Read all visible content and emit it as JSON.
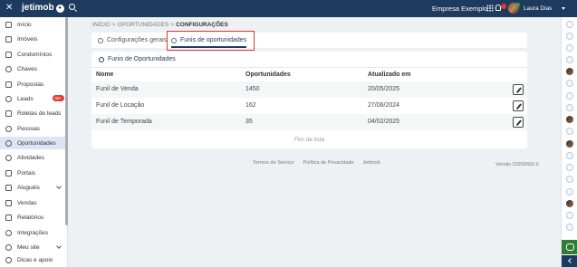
{
  "app": {
    "logo_text": "jetimob",
    "company": "Empresa Exemplo",
    "user_name": "Laura Dias"
  },
  "sidebar": {
    "items": [
      {
        "label": "Início",
        "icon": "home-icon"
      },
      {
        "label": "Imóveis",
        "icon": "building-icon"
      },
      {
        "label": "Condomínios",
        "icon": "condo-icon"
      },
      {
        "label": "Chaves",
        "icon": "key-icon"
      },
      {
        "label": "Propostas",
        "icon": "proposal-icon"
      },
      {
        "label": "Leads",
        "icon": "leads-icon",
        "badge": "99+"
      },
      {
        "label": "Roletas de leads",
        "icon": "roulette-icon"
      },
      {
        "label": "Pessoas",
        "icon": "people-icon"
      },
      {
        "label": "Oportunidades",
        "icon": "opportunity-icon",
        "active": true
      },
      {
        "label": "Atividades",
        "icon": "check-icon"
      },
      {
        "label": "Portais",
        "icon": "megaphone-icon"
      },
      {
        "label": "Aluguéis",
        "icon": "rent-icon",
        "expandable": true
      },
      {
        "label": "Vendas",
        "icon": "sales-icon"
      },
      {
        "label": "Relatórios",
        "icon": "report-icon"
      },
      {
        "label": "Integrações",
        "icon": "integration-icon"
      },
      {
        "label": "Meu site",
        "icon": "globe-icon",
        "expandable": true
      },
      {
        "label": "Dicas e apoio",
        "icon": "help-icon"
      }
    ]
  },
  "breadcrumb": {
    "items": [
      "INÍCIO",
      "OPORTUNIDADES",
      "CONFIGURAÇÕES"
    ],
    "separator": ">"
  },
  "tabs": [
    {
      "label": "Configurações gerais",
      "active": false
    },
    {
      "label": "Funis de oportunidades",
      "active": true
    }
  ],
  "funnels": {
    "title": "Funis de Oportunidades",
    "columns": [
      "Nome",
      "Oportunidades",
      "Atualizado em"
    ],
    "rows": [
      {
        "name": "Funil de Venda",
        "count": "1450",
        "updated": "20/05/2025"
      },
      {
        "name": "Funil de Locação",
        "count": "162",
        "updated": "27/06/2024"
      },
      {
        "name": "Funil de Temporada",
        "count": "35",
        "updated": "04/02/2025"
      }
    ],
    "end_text": "Fim da lista"
  },
  "footer": {
    "links": [
      "Termos de Serviço",
      "Política de Privacidade",
      "Jetimob"
    ],
    "version": "Versão 20250602.0"
  },
  "colors": {
    "brand": "#1f3a5f",
    "highlight": "#e53935",
    "badge": "#e53935"
  }
}
